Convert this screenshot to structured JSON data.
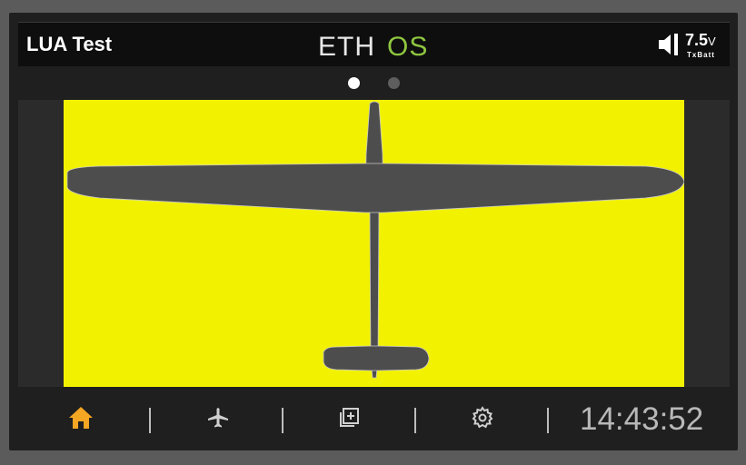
{
  "header": {
    "title": "LUA Test",
    "logo_text_left": "ETH",
    "logo_text_right": "OS",
    "battery_value": "7.5",
    "battery_unit": "V",
    "battery_label": "TxBatt"
  },
  "pages": {
    "total": 2,
    "current": 1
  },
  "main": {
    "background_color": "#f2f200",
    "image_icon": "glider-silhouette"
  },
  "nav": {
    "items": [
      {
        "icon": "home-icon",
        "active": true
      },
      {
        "icon": "airplane-icon",
        "active": false
      },
      {
        "icon": "add-widget-icon",
        "active": false
      },
      {
        "icon": "gear-icon",
        "active": false
      }
    ],
    "time": "14:43:52",
    "active_color": "#f5a623"
  }
}
